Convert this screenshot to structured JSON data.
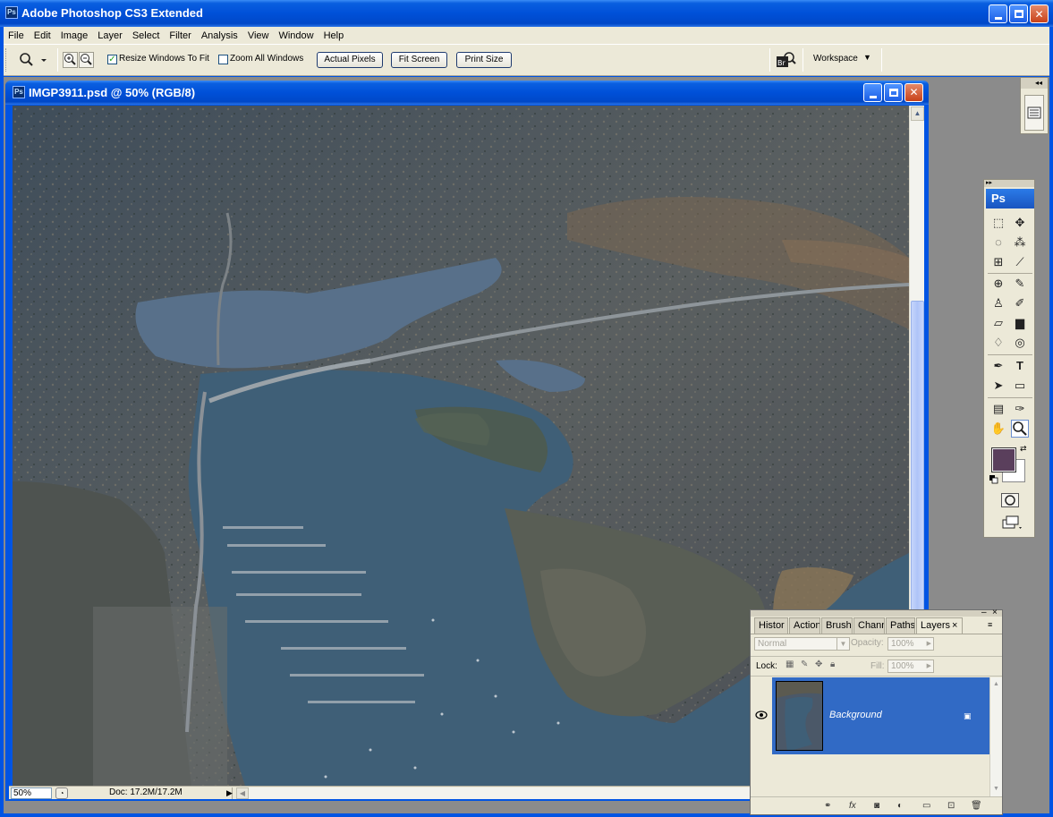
{
  "app": {
    "title": "Adobe Photoshop CS3 Extended",
    "icon_text": "Ps"
  },
  "menu": [
    "File",
    "Edit",
    "Image",
    "Layer",
    "Select",
    "Filter",
    "Analysis",
    "View",
    "Window",
    "Help"
  ],
  "options": {
    "resize_windows_label": "Resize Windows To Fit",
    "resize_windows_checked": true,
    "zoom_all_label": "Zoom All Windows",
    "zoom_all_checked": false,
    "actual_pixels": "Actual Pixels",
    "fit_screen": "Fit Screen",
    "print_size": "Print Size",
    "workspace": "Workspace"
  },
  "document": {
    "title": "IMGP3911.psd @ 50% (RGB/8)",
    "zoom": "50%",
    "doc_info": "Doc: 17.2M/17.2M"
  },
  "tools": {
    "badge": "Ps",
    "foreground_color": "#5a3f5c",
    "background_color": "#ffffff"
  },
  "layers_panel": {
    "tabs": [
      "Histor",
      "Action",
      "Brushe",
      "Chann",
      "Paths",
      "Layers"
    ],
    "active_tab": "Layers",
    "blend_mode": "Normal",
    "opacity_label": "Opacity:",
    "opacity_value": "100%",
    "lock_label": "Lock:",
    "fill_label": "Fill:",
    "fill_value": "100%",
    "layer_name": "Background"
  },
  "colors": {
    "xp_blue": "#0054e3",
    "chrome": "#ece9d8",
    "selection": "#316ac5"
  }
}
